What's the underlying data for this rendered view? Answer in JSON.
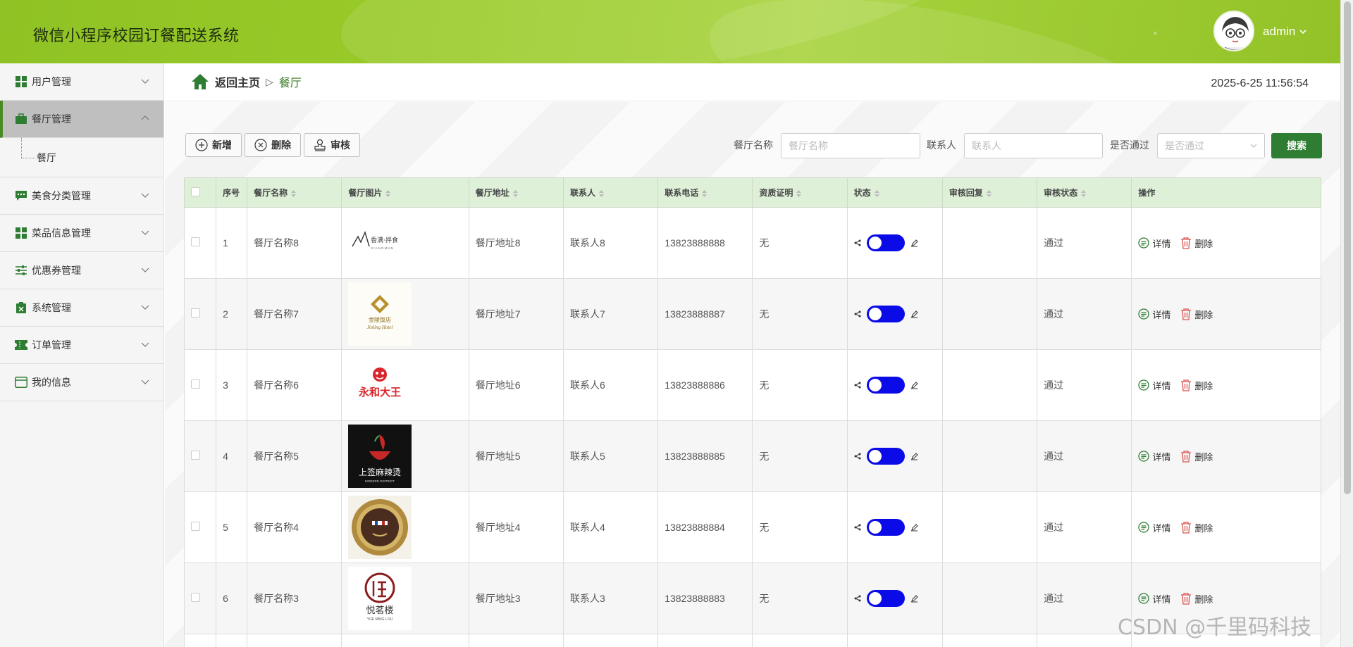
{
  "header": {
    "title": "微信小程序校园订餐配送系统",
    "dot": "。",
    "username": "admin"
  },
  "sidebar": {
    "items": [
      {
        "label": "用户管理",
        "icon": "grid-icon"
      },
      {
        "label": "餐厅管理",
        "icon": "briefcase-icon",
        "active": true
      },
      {
        "label": "美食分类管理",
        "icon": "chat-icon"
      },
      {
        "label": "菜品信息管理",
        "icon": "grid-icon"
      },
      {
        "label": "优惠券管理",
        "icon": "sliders-icon"
      },
      {
        "label": "系统管理",
        "icon": "clipboard-icon"
      },
      {
        "label": "订单管理",
        "icon": "ticket-icon"
      },
      {
        "label": "我的信息",
        "icon": "card-icon"
      }
    ],
    "submenu": {
      "label": "餐厅"
    }
  },
  "breadcrumb": {
    "home": "返回主页",
    "separator": "▷",
    "current": "餐厅"
  },
  "datetime": "2025-6-25 11:56:54",
  "toolbar": {
    "add": "新增",
    "delete": "删除",
    "audit": "审核"
  },
  "search": {
    "name_label": "餐厅名称",
    "name_placeholder": "餐厅名称",
    "contact_label": "联系人",
    "contact_placeholder": "联系人",
    "passed_label": "是否通过",
    "passed_placeholder": "是否通过",
    "button": "搜索"
  },
  "table": {
    "columns": [
      "序号",
      "餐厅名称",
      "餐厅图片",
      "餐厅地址",
      "联系人",
      "联系电话",
      "资质证明",
      "状态",
      "审核回复",
      "审核状态",
      "操作"
    ],
    "rows": [
      {
        "index": "1",
        "name": "餐厅名称8",
        "image": "logo-xiangman",
        "address": "餐厅地址8",
        "contact": "联系人8",
        "phone": "13823888888",
        "cert": "无",
        "reply": "",
        "audit": "通过"
      },
      {
        "index": "2",
        "name": "餐厅名称7",
        "image": "logo-jinling-hotel",
        "address": "餐厅地址7",
        "contact": "联系人7",
        "phone": "13823888887",
        "cert": "无",
        "reply": "",
        "audit": "通过"
      },
      {
        "index": "3",
        "name": "餐厅名称6",
        "image": "logo-yonghe",
        "address": "餐厅地址6",
        "contact": "联系人6",
        "phone": "13823888886",
        "cert": "无",
        "reply": "",
        "audit": "通过"
      },
      {
        "index": "4",
        "name": "餐厅名称5",
        "image": "logo-malatang",
        "address": "餐厅地址5",
        "contact": "联系人5",
        "phone": "13823888885",
        "cert": "无",
        "reply": "",
        "audit": "通过"
      },
      {
        "index": "5",
        "name": "餐厅名称4",
        "image": "logo-gold-badge",
        "address": "餐厅地址4",
        "contact": "联系人4",
        "phone": "13823888884",
        "cert": "无",
        "reply": "",
        "audit": "通过"
      },
      {
        "index": "6",
        "name": "餐厅名称3",
        "image": "logo-yuemingju",
        "address": "餐厅地址3",
        "contact": "联系人3",
        "phone": "13823888883",
        "cert": "无",
        "reply": "",
        "audit": "通过"
      }
    ],
    "detail_label": "详情",
    "delete_label": "删除"
  },
  "logos": {
    "xiangman_main": "香满·拌食",
    "xiangman_sub": "X I A N G M A N",
    "jinling_main": "金陵饭店",
    "jinling_sub": "Jinling Hotel",
    "yonghe": "永和大王",
    "malatang_main": "上签麻辣烫",
    "malatang_sub": "MODERN DISTRICT",
    "yuemingju_main": "悦茗楼",
    "yuemingju_sub": "YUE MING LOU"
  },
  "watermark": "CSDN @千里码科技",
  "colors": {
    "header": "#9acb2a",
    "primary_button": "#2e7d32",
    "table_header": "#dff0d8",
    "toggle": "#0b0be8"
  }
}
